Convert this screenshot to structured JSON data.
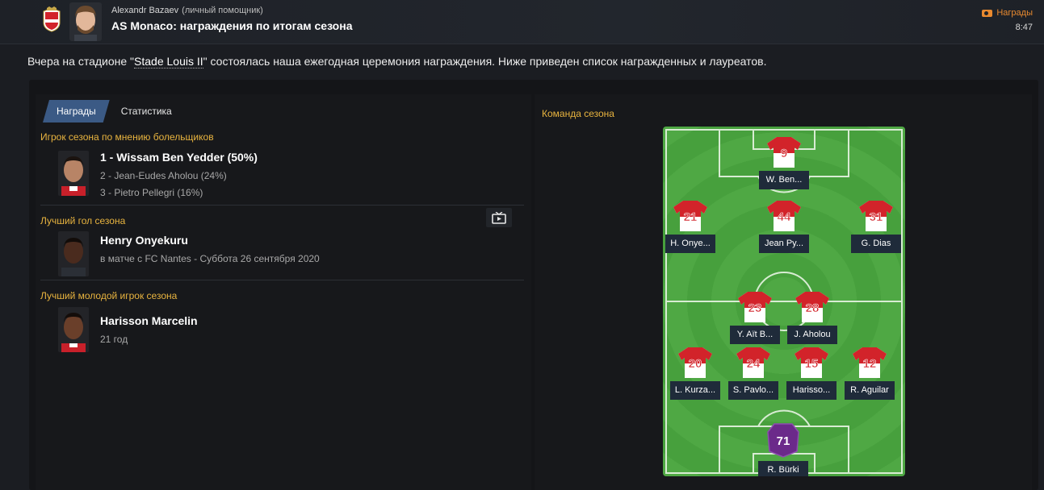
{
  "header": {
    "sender_name": "Alexandr Bazaev",
    "sender_role": "(личный помощник)",
    "subject": "AS Monaco: награждения по итогам сезона",
    "tag": "Награды",
    "time": "8:47"
  },
  "intro": {
    "before": "Вчера на стадионе \"",
    "stadium": "Stade Louis II",
    "after": "\" состоялась наша ежегодная церемония награждения. Ниже приведен список награжденных и лауреатов."
  },
  "tabs": [
    "Награды",
    "Статистика"
  ],
  "awards": {
    "fans_player": {
      "title": "Игрок сезона по мнению болельщиков",
      "winner": "1 - Wissam Ben Yedder (50%)",
      "second": "2 - Jean-Eudes Aholou (24%)",
      "third": "3 - Pietro Pellegri (16%)"
    },
    "best_goal": {
      "title": "Лучший гол сезона",
      "winner": "Henry Onyekuru",
      "detail": "в матче с FC Nantes - Суббота 26 сентября 2020"
    },
    "young_player": {
      "title": "Лучший молодой игрок сезона",
      "winner": "Harisson Marcelin",
      "detail": "21 год"
    }
  },
  "team_of_season": {
    "title": "Команда сезона",
    "players": {
      "st": {
        "name": "W. Ben...",
        "number": "9"
      },
      "lw": {
        "name": "H. Onye...",
        "number": "21"
      },
      "am": {
        "name": "Jean Py...",
        "number": "44"
      },
      "rw": {
        "name": "G. Dias",
        "number": "31"
      },
      "cm1": {
        "name": "Y. Aït B...",
        "number": "23"
      },
      "cm2": {
        "name": "J. Aholou",
        "number": "28"
      },
      "lb": {
        "name": "L. Kurza...",
        "number": "20"
      },
      "cb1": {
        "name": "S. Pavlo...",
        "number": "24"
      },
      "cb2": {
        "name": "Harisso...",
        "number": "15"
      },
      "rb": {
        "name": "R. Aguilar",
        "number": "12"
      },
      "gk": {
        "name": "R. Bürki",
        "rating": "71"
      }
    }
  },
  "colors": {
    "accent_gold": "#e9b43f",
    "tag_orange": "#e98a2f",
    "tab_active": "#3b5a85",
    "pitch_green": "#4fa844",
    "shirt_red": "#d2232a",
    "gk_purple": "#6b2a8a"
  }
}
